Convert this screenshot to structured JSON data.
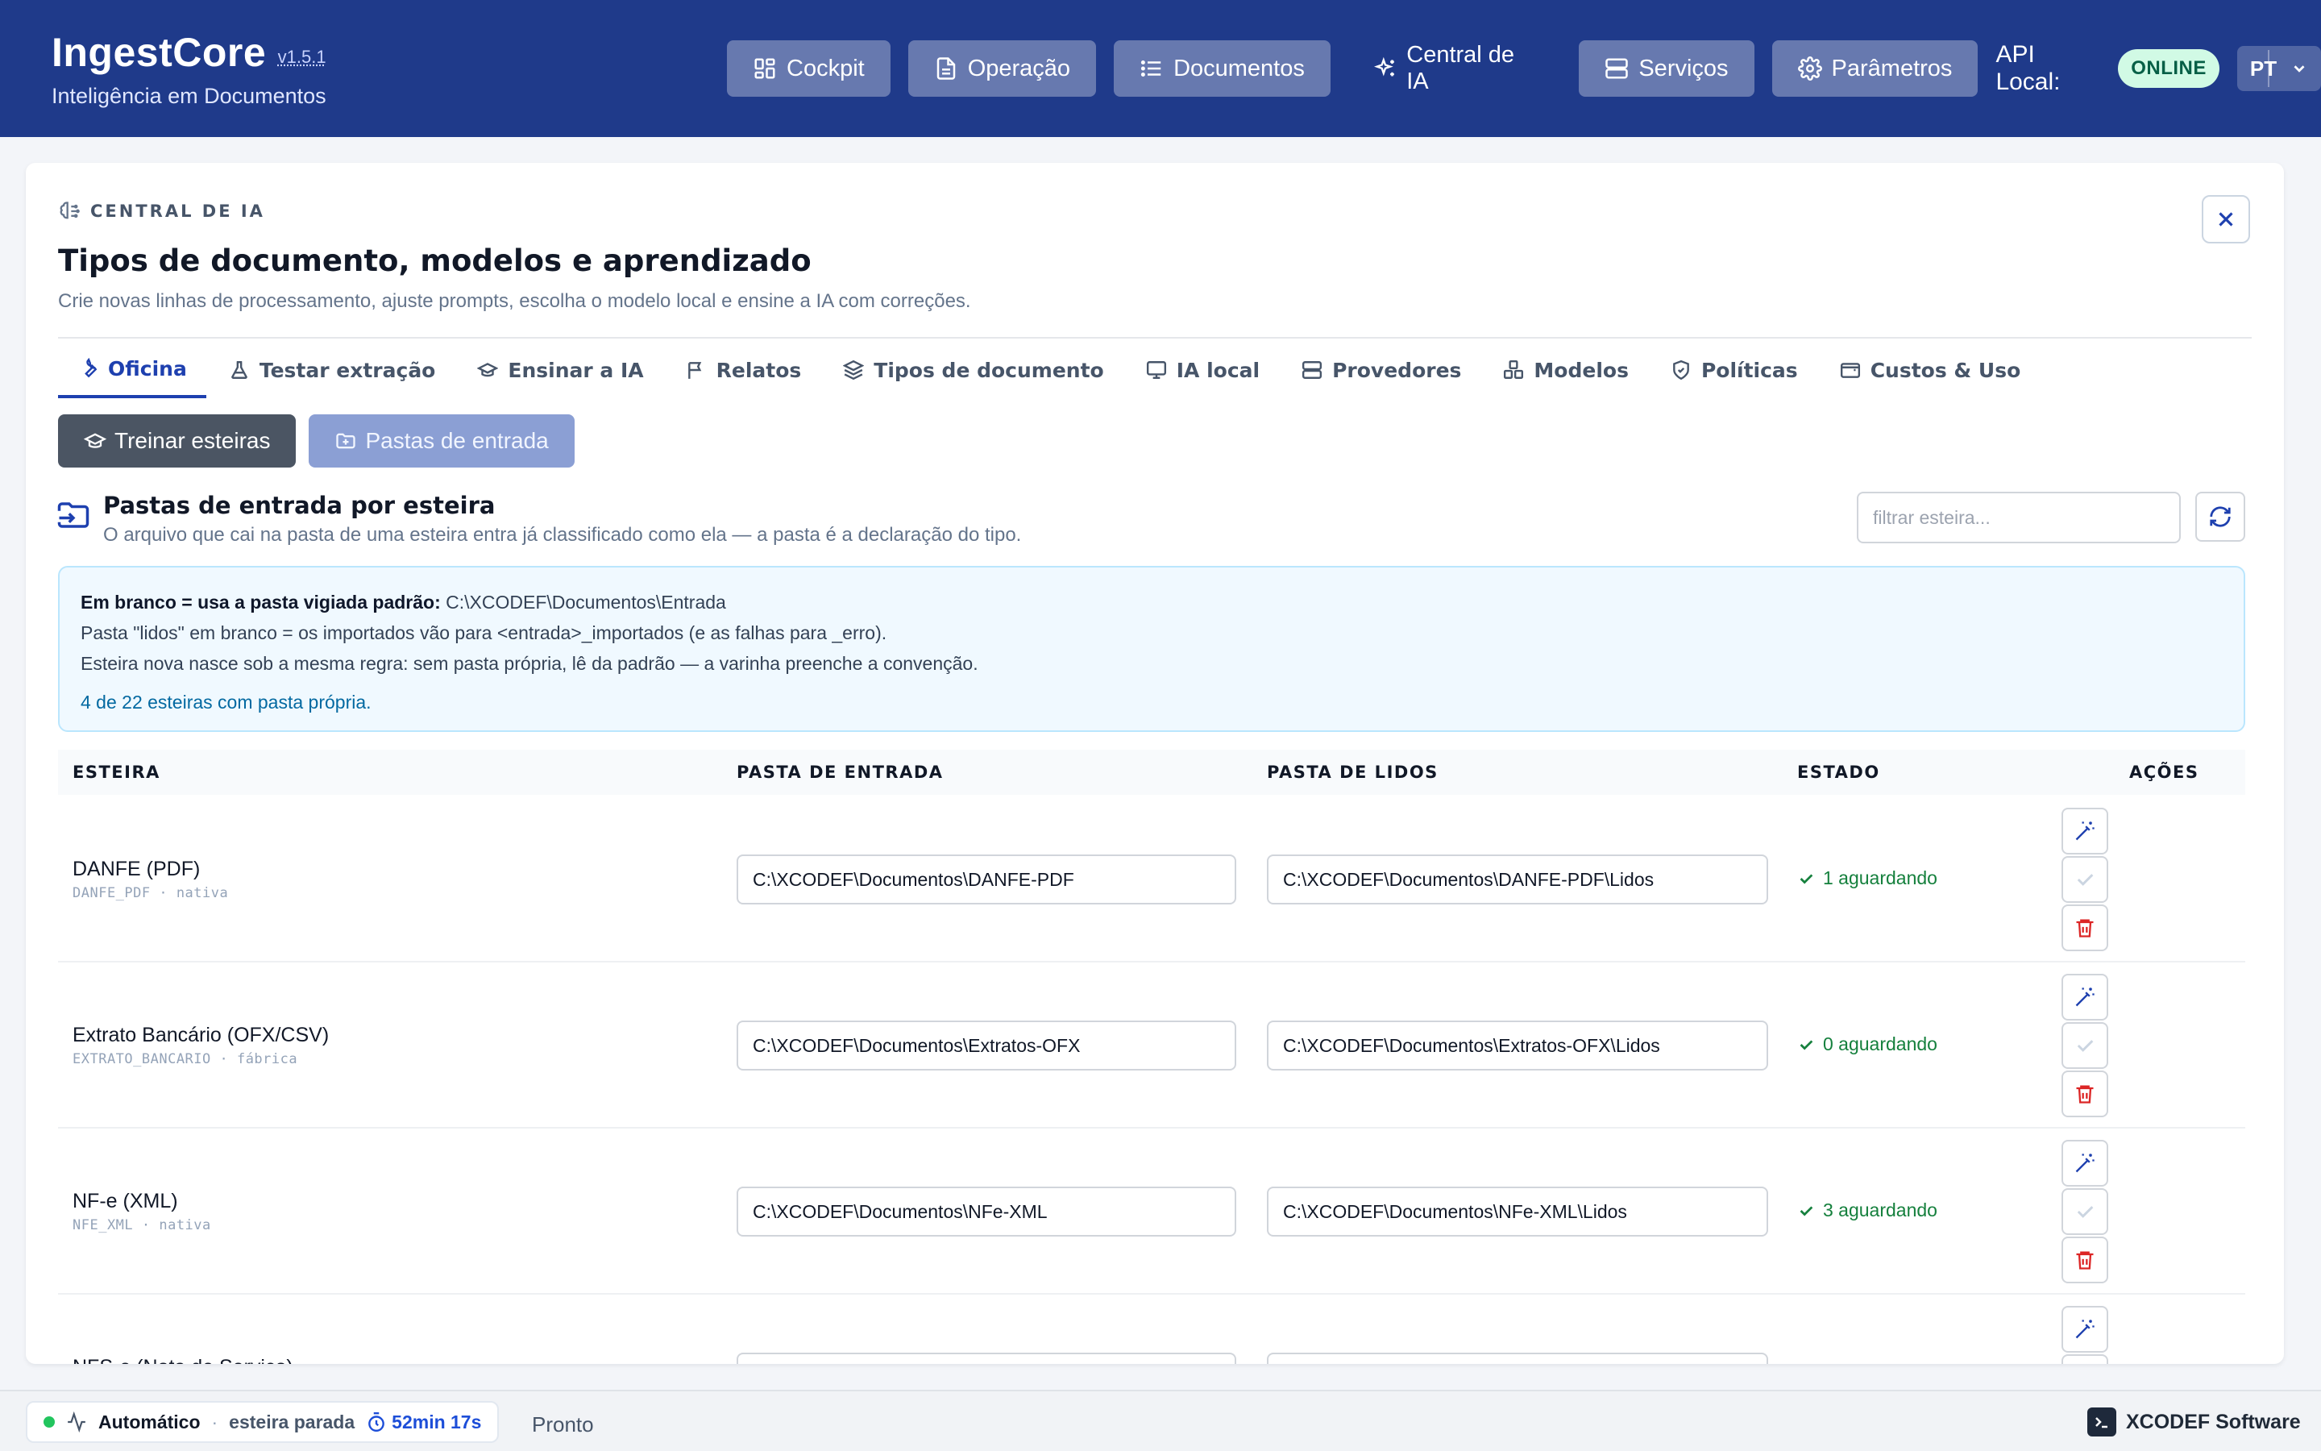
{
  "app": {
    "name": "IngestCore",
    "version": "v1.5.1",
    "tagline": "Inteligência em Documentos"
  },
  "nav": {
    "items": [
      {
        "label": "Cockpit",
        "icon": "grid-icon"
      },
      {
        "label": "Operação",
        "icon": "document-icon"
      },
      {
        "label": "Documentos",
        "icon": "list-icon"
      },
      {
        "label": "Central de IA",
        "icon": "sparkles-icon",
        "active": true
      },
      {
        "label": "Serviços",
        "icon": "server-icon"
      },
      {
        "label": "Parâmetros",
        "icon": "gear-icon"
      }
    ],
    "api_label": "API Local:",
    "api_status": "ONLINE",
    "language": "PT"
  },
  "panel": {
    "eyebrow": "CENTRAL DE IA",
    "title": "Tipos de documento, modelos e aprendizado",
    "subtitle": "Crie novas linhas de processamento, ajuste prompts, escolha o modelo local e ensine a IA com correções.",
    "tabs": [
      {
        "label": "Oficina",
        "icon": "wrench-icon",
        "active": true
      },
      {
        "label": "Testar extração",
        "icon": "flask-icon"
      },
      {
        "label": "Ensinar a IA",
        "icon": "graduation-cap-icon"
      },
      {
        "label": "Relatos",
        "icon": "flag-icon"
      },
      {
        "label": "Tipos de documento",
        "icon": "layers-icon"
      },
      {
        "label": "IA local",
        "icon": "monitor-icon"
      },
      {
        "label": "Provedores",
        "icon": "server-icon"
      },
      {
        "label": "Modelos",
        "icon": "boxes-icon"
      },
      {
        "label": "Políticas",
        "icon": "shield-icon"
      },
      {
        "label": "Custos & Uso",
        "icon": "wallet-icon"
      }
    ],
    "sub_buttons": {
      "train": "Treinar esteiras",
      "folders": "Pastas de entrada"
    }
  },
  "section": {
    "title": "Pastas de entrada por esteira",
    "description": "O arquivo que cai na pasta de uma esteira entra já classificado como ela — a pasta é a declaração do tipo.",
    "filter_placeholder": "filtrar esteira..."
  },
  "info": {
    "default_label": "Em branco = usa a pasta vigiada padrão:",
    "default_path": "C:\\XCODEF\\Documentos\\Entrada",
    "line2": "Pasta \"lidos\" em branco = os importados vão para <entrada>_importados (e as falhas para _erro).",
    "line3": "Esteira nova nasce sob a mesma regra: sem pasta própria, lê da padrão — a varinha preenche a convenção.",
    "count": "4 de 22 esteiras com pasta própria."
  },
  "table": {
    "headers": {
      "esteira": "ESTEIRA",
      "entrada": "PASTA DE ENTRADA",
      "lidos": "PASTA DE LIDOS",
      "estado": "ESTADO",
      "acoes": "AÇÕES"
    },
    "rows": [
      {
        "name": "DANFE (PDF)",
        "meta": "DANFE_PDF · nativa",
        "entrada": "C:\\XCODEF\\Documentos\\DANFE-PDF",
        "lidos": "C:\\XCODEF\\Documentos\\DANFE-PDF\\Lidos",
        "status": "1 aguardando"
      },
      {
        "name": "Extrato Bancário (OFX/CSV)",
        "meta": "EXTRATO_BANCARIO · fábrica",
        "entrada": "C:\\XCODEF\\Documentos\\Extratos-OFX",
        "lidos": "C:\\XCODEF\\Documentos\\Extratos-OFX\\Lidos",
        "status": "0 aguardando"
      },
      {
        "name": "NF-e (XML)",
        "meta": "NFE_XML · nativa",
        "entrada": "C:\\XCODEF\\Documentos\\NFe-XML",
        "lidos": "C:\\XCODEF\\Documentos\\NFe-XML\\Lidos",
        "status": "3 aguardando"
      },
      {
        "name": "NFS-e (Nota de Serviço)",
        "meta": "",
        "entrada": "",
        "lidos": "",
        "status": ""
      }
    ]
  },
  "statusbar": {
    "mode": "Automático",
    "separator": "·",
    "state": "esteira parada",
    "timer": "52min 17s",
    "ready": "Pronto",
    "brand": "XCODEF Software"
  },
  "colors": {
    "header_bg": "#1f3a8a",
    "accent": "#1e40af",
    "online_badge": "#d1fae5",
    "status_ok": "#15803d",
    "danger": "#dc2626"
  }
}
